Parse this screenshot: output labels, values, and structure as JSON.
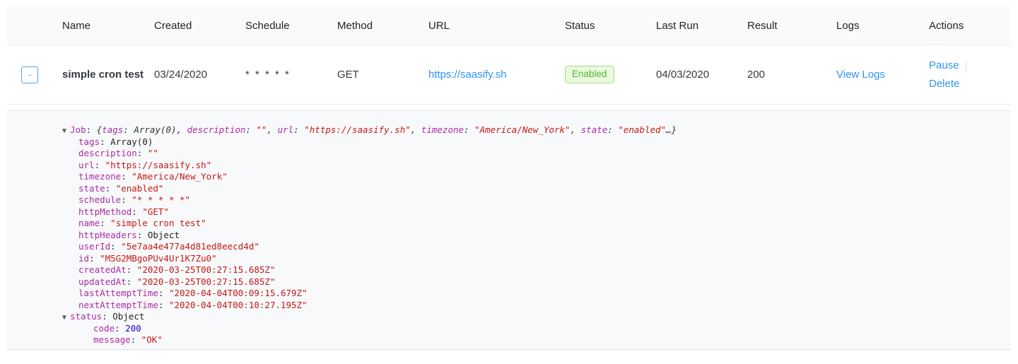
{
  "table": {
    "columns": [
      "",
      "Name",
      "Created",
      "Schedule",
      "Method",
      "URL",
      "Status",
      "Last Run",
      "Result",
      "Logs",
      "Actions"
    ],
    "row": {
      "toggle_label": "-",
      "name": "simple cron test",
      "created": "03/24/2020",
      "schedule": "* * * * *",
      "method": "GET",
      "url": "https://saasify.sh",
      "status": "Enabled",
      "last_run": "04/03/2020",
      "result": "200",
      "logs_link": "View Logs",
      "action_pause": "Pause",
      "action_delete": "Delete"
    }
  },
  "detail": {
    "root": {
      "arrow": "▼",
      "key": "Job",
      "colon": ": ",
      "preview_open": "{",
      "preview": [
        {
          "key": "tags",
          "sep": ": ",
          "val": "Array(0)",
          "kind": "plain",
          "tail": ", "
        },
        {
          "key": "description",
          "sep": ": ",
          "val": "\"\"",
          "kind": "str",
          "tail": ", "
        },
        {
          "key": "url",
          "sep": ": ",
          "val": "\"https://saasify.sh\"",
          "kind": "str",
          "tail": ", "
        },
        {
          "key": "timezone",
          "sep": ": ",
          "val": "\"America/New_York\"",
          "kind": "str",
          "tail": ", "
        },
        {
          "key": "state",
          "sep": ": ",
          "val": "\"enabled\"",
          "kind": "str",
          "tail": ""
        }
      ],
      "preview_close": "…}"
    },
    "props": [
      {
        "indent": 1,
        "arrow": "",
        "key": "tags",
        "val": "Array(0)",
        "kind": "plain"
      },
      {
        "indent": 1,
        "arrow": "",
        "key": "description",
        "val": "\"\"",
        "kind": "str"
      },
      {
        "indent": 1,
        "arrow": "",
        "key": "url",
        "val": "\"https://saasify.sh\"",
        "kind": "str"
      },
      {
        "indent": 1,
        "arrow": "",
        "key": "timezone",
        "val": "\"America/New_York\"",
        "kind": "str"
      },
      {
        "indent": 1,
        "arrow": "",
        "key": "state",
        "val": "\"enabled\"",
        "kind": "str"
      },
      {
        "indent": 1,
        "arrow": "",
        "key": "schedule",
        "val": "\"* * * * *\"",
        "kind": "str"
      },
      {
        "indent": 1,
        "arrow": "",
        "key": "httpMethod",
        "val": "\"GET\"",
        "kind": "str"
      },
      {
        "indent": 1,
        "arrow": "",
        "key": "name",
        "val": "\"simple cron test\"",
        "kind": "str"
      },
      {
        "indent": 1,
        "arrow": "",
        "key": "httpHeaders",
        "val": "Object",
        "kind": "plain"
      },
      {
        "indent": 1,
        "arrow": "",
        "key": "userId",
        "val": "\"5e7aa4e477a4d81ed8eecd4d\"",
        "kind": "str"
      },
      {
        "indent": 1,
        "arrow": "",
        "key": "id",
        "val": "\"M5G2MBgoPUv4Ur1K7Zu0\"",
        "kind": "str"
      },
      {
        "indent": 1,
        "arrow": "",
        "key": "createdAt",
        "val": "\"2020-03-25T00:27:15.685Z\"",
        "kind": "str"
      },
      {
        "indent": 1,
        "arrow": "",
        "key": "updatedAt",
        "val": "\"2020-03-25T00:27:15.685Z\"",
        "kind": "str"
      },
      {
        "indent": 1,
        "arrow": "",
        "key": "lastAttemptTime",
        "val": "\"2020-04-04T00:09:15.679Z\"",
        "kind": "str"
      },
      {
        "indent": 1,
        "arrow": "",
        "key": "nextAttemptTime",
        "val": "\"2020-04-04T00:10:27.195Z\"",
        "kind": "str"
      },
      {
        "indent": 0,
        "arrow": "▼",
        "key": "status",
        "val": "Object",
        "kind": "plain"
      },
      {
        "indent": 2,
        "arrow": "",
        "key": "code",
        "val": "200",
        "kind": "num"
      },
      {
        "indent": 2,
        "arrow": "",
        "key": "message",
        "val": "\"OK\"",
        "kind": "str"
      }
    ]
  },
  "colors": {
    "link": "#2f93f6",
    "badge_text": "#5bb52c",
    "badge_bg": "#eaf9e0",
    "badge_border": "#9fdf7a",
    "key": "#ac2ba5",
    "string": "#c41a16",
    "number": "#1c00cf"
  }
}
